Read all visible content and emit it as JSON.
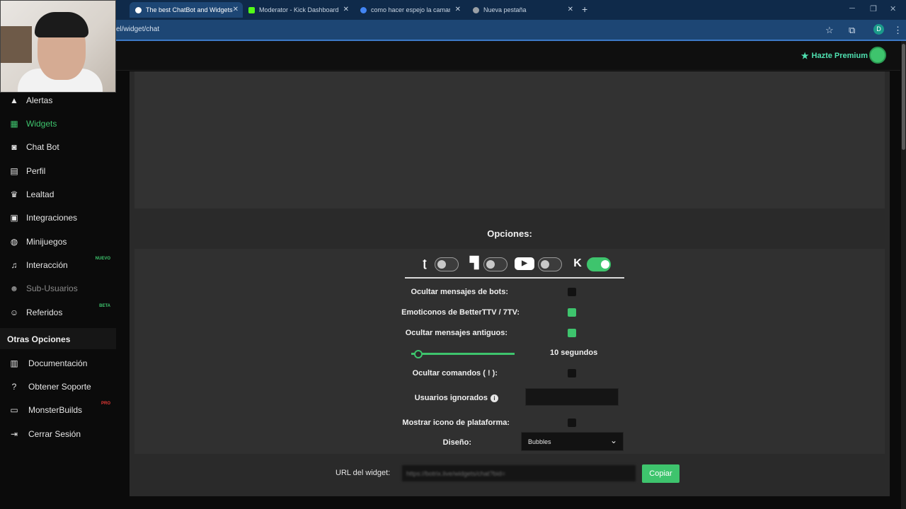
{
  "browser": {
    "tabs": [
      {
        "title": "The best ChatBot and Widgets",
        "favicon_color": "#ffffff"
      },
      {
        "title": "Moderator - Kick Dashboard",
        "favicon_color": "#53fc18"
      },
      {
        "title": "como hacer espejo la camara e",
        "favicon_color": "#4285f4"
      },
      {
        "title": "Nueva pestaña",
        "favicon_color": "#9aa0a6"
      }
    ],
    "new_tab": "+",
    "url": "el/widget/chat",
    "profile_initial": "D"
  },
  "header": {
    "premium_label": "Hazte Premium"
  },
  "sidebar": {
    "items": [
      {
        "label": "Alertas",
        "icon": "warning-icon"
      },
      {
        "label": "Widgets",
        "icon": "grid-icon",
        "active": true
      },
      {
        "label": "Chat Bot",
        "icon": "robot-icon"
      },
      {
        "label": "Perfil",
        "icon": "id-card-icon"
      },
      {
        "label": "Lealtad",
        "icon": "trophy-icon"
      },
      {
        "label": "Integraciones",
        "icon": "plug-icon"
      },
      {
        "label": "Minijuegos",
        "icon": "gamepad-icon"
      },
      {
        "label": "Interacción",
        "icon": "music-icon",
        "badge": "NUEVO"
      },
      {
        "label": "Sub-Usuarios",
        "icon": "users-icon",
        "muted": true
      },
      {
        "label": "Referidos",
        "icon": "referral-icon",
        "badge": "BETA"
      }
    ],
    "other_title": "Otras Opciones",
    "other_items": [
      {
        "label": "Documentación",
        "icon": "book-icon"
      },
      {
        "label": "Obtener Soporte",
        "icon": "help-icon"
      },
      {
        "label": "MonsterBuilds",
        "icon": "laptop-icon",
        "badge": "PRO"
      },
      {
        "label": "Cerrar Sesión",
        "icon": "logout-icon"
      }
    ],
    "accent": "#3ec46d",
    "badge_color": "#3ec46d",
    "pro_badge_color": "#e53935"
  },
  "options": {
    "title": "Opciones:",
    "platforms": [
      {
        "name": "Trovo",
        "icon": "trovo-icon",
        "enabled": false
      },
      {
        "name": "Twitch",
        "icon": "twitch-icon",
        "enabled": false
      },
      {
        "name": "YouTube",
        "icon": "youtube-icon",
        "enabled": false
      },
      {
        "name": "Kick",
        "icon": "kick-icon",
        "enabled": true
      }
    ],
    "hide_bots_label": "Ocultar mensajes de bots:",
    "hide_bots": false,
    "emotes_label": "Emoticonos de BetterTTV / 7TV:",
    "emotes": true,
    "hide_old_label": "Ocultar mensajes antiguos:",
    "hide_old": true,
    "timeout_label": "10 segundos",
    "timeout_seconds": 10,
    "hide_commands_label": "Ocultar comandos ( ! ):",
    "hide_commands": false,
    "ignored_users_label": "Usuarios ignorados",
    "ignored_users_value": "",
    "show_platform_icon_label": "Mostrar icono de plataforma:",
    "show_platform_icon": false,
    "design_label": "Diseño:",
    "design_value": "Bubbles"
  },
  "widget_url": {
    "label": "URL del widget:",
    "value": "https://botrix.live/widgets/chat?bid=",
    "copy_label": "Copiar"
  }
}
